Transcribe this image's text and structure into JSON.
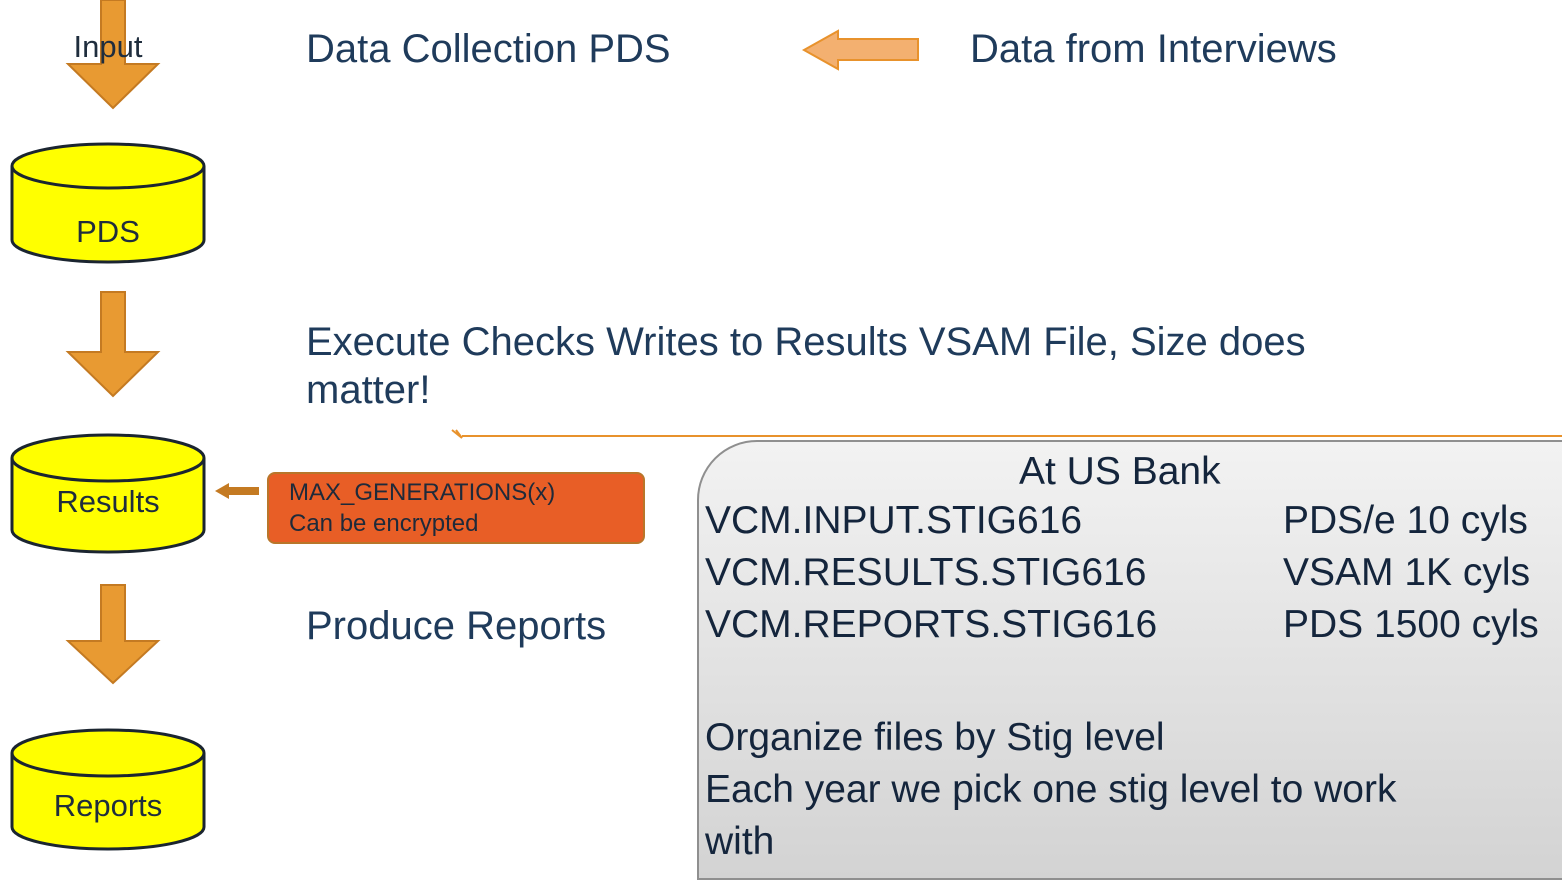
{
  "colors": {
    "arrow_fill": "#e89a32",
    "arrow_stroke": "#c47a22",
    "cylinder_fill": "#ffff00",
    "cylinder_stroke": "#1b2530",
    "callout_fill": "#e85e26",
    "text": "#1f3b5b",
    "connector": "#e8922c"
  },
  "flow": {
    "input_db": {
      "line1": "Input",
      "line2": "PDS"
    },
    "results_db": {
      "label": "Results"
    },
    "reports_db": {
      "label": "Reports"
    }
  },
  "steps": {
    "data_collection": "Data Collection PDS",
    "data_source": "Data from Interviews",
    "execute_checks_line1": "Execute Checks   Writes to Results VSAM File,  Size does",
    "execute_checks_line2": "matter!",
    "produce_reports": "Produce Reports"
  },
  "callout": {
    "line1": "MAX_GENERATIONS(x)",
    "line2": "Can be encrypted"
  },
  "panel": {
    "title": "At US Bank",
    "datasets": [
      {
        "name": "VCM.INPUT.STIG616",
        "desc": "PDS/e 10 cyls"
      },
      {
        "name": "VCM.RESULTS.STIG616",
        "desc": "VSAM 1K cyls"
      },
      {
        "name": "VCM.REPORTS.STIG616",
        "desc": "PDS 1500 cyls"
      }
    ],
    "note_line1": "Organize files by Stig level",
    "note_line2": "Each year we pick one stig level to work",
    "note_line3": "with"
  }
}
